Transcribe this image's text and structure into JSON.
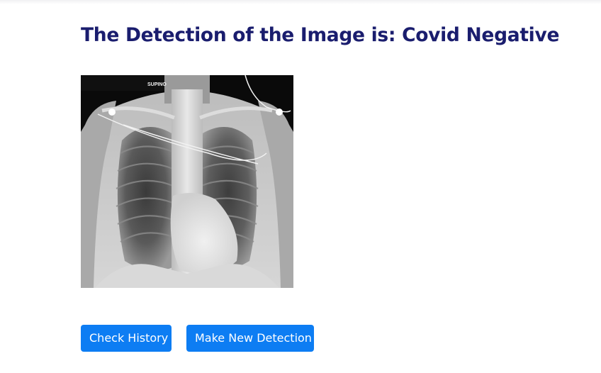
{
  "result": {
    "prefix": "The Detection of the Image is: ",
    "label": "Covid Negative"
  },
  "xray": {
    "marker_text": "SUPINO"
  },
  "actions": {
    "history_label": "Check History",
    "new_detection_label": "Make New Detection"
  },
  "colors": {
    "title": "#1a1d6e",
    "button_bg": "#0d7df3",
    "button_text": "#ffffff"
  }
}
